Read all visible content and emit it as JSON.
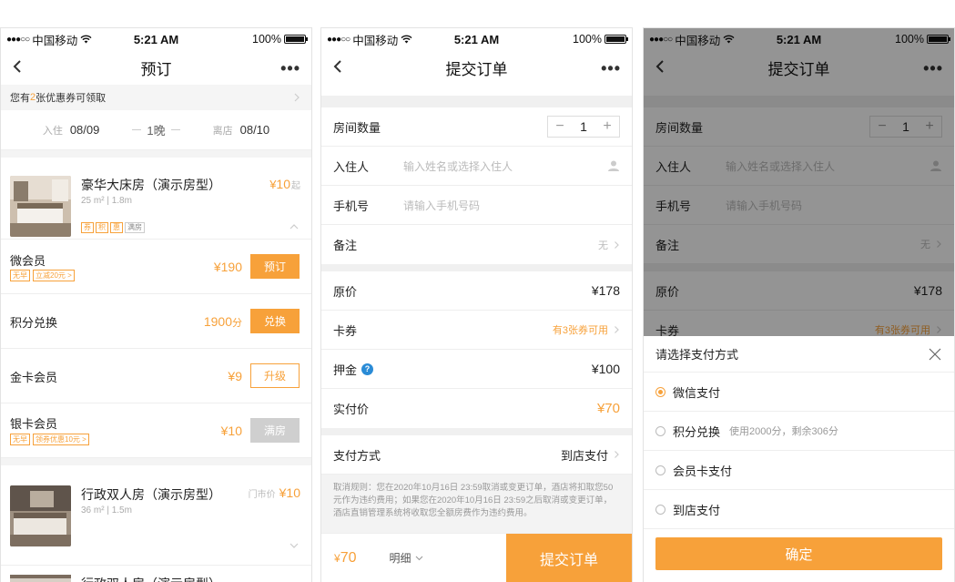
{
  "status": {
    "dots": "●●●○○",
    "carrier": "中国移动",
    "time": "5:21 AM",
    "battery": "100%"
  },
  "screen1": {
    "title": "预订",
    "coupon_pre": "您有 ",
    "coupon_num": "2",
    "coupon_post": " 张优惠券可领取",
    "checkin_label": "入住",
    "checkin_date": "08/09",
    "nights": "1晚",
    "checkout_label": "离店",
    "checkout_date": "08/10",
    "room1": {
      "name": "豪华大床房（演示房型）",
      "spec": "25 m² | 1.8m",
      "tags": [
        "券",
        "积",
        "惠",
        "满房"
      ],
      "price_sym": "¥",
      "price": "10",
      "suffix": "起"
    },
    "plans": [
      {
        "name": "微会员",
        "tags": [
          "无早",
          "立减20元 >"
        ],
        "price": "¥190",
        "button": "预订"
      },
      {
        "name": "积分兑换",
        "price": "1900",
        "price_unit": "分",
        "button": "兑换"
      },
      {
        "name": "金卡会员",
        "price": "¥9",
        "button": "升级"
      },
      {
        "name": "银卡会员",
        "tags": [
          "无早",
          "领券优惠10元 >"
        ],
        "price": "¥10",
        "button": "满房"
      }
    ],
    "room2": {
      "name": "行政双人房（演示房型）",
      "spec": "36 m² | 1.5m",
      "market_label": "门市价",
      "price": "¥10"
    },
    "room3": {
      "name": "行政双人房（演示房型）"
    }
  },
  "screen2": {
    "title": "提交订单",
    "room_count_label": "房间数量",
    "room_count": "1",
    "guest_label": "入住人",
    "guest_placeholder": "输入姓名或选择入住人",
    "phone_label": "手机号",
    "phone_placeholder": "请输入手机号码",
    "remark_label": "备注",
    "remark_value": "无",
    "original_label": "原价",
    "original_price": "¥178",
    "coupon_label": "卡券",
    "coupon_value": "有3张券可用",
    "deposit_label": "押金",
    "deposit_value": "¥100",
    "actual_label": "实付价",
    "actual_value": "¥70",
    "pay_label": "支付方式",
    "pay_value": "到店支付",
    "rules": "取消规则：您在2020年10月16日 23:59取消或变更订单，酒店将扣取您50元作为违约费用；如果您在2020年10月16日 23:59之后取消或变更订单，酒店直销管理系统将收取您全额房费作为违约费用。",
    "total_sym": "¥",
    "total": "70",
    "detail_label": "明细",
    "submit_label": "提交订单"
  },
  "screen3": {
    "sheet_title": "请选择支付方式",
    "options": [
      {
        "label": "微信支付",
        "selected": true
      },
      {
        "label": "积分兑换",
        "note": "使用2000分，剩余306分"
      },
      {
        "label": "会员卡支付"
      },
      {
        "label": "到店支付"
      }
    ],
    "confirm_label": "确定"
  },
  "colors": {
    "accent": "#f7a13a",
    "disabled": "#cfcfcf",
    "info": "#2a8bd6"
  },
  "icons": [
    "back-icon",
    "more-icon",
    "wifi-icon",
    "battery-icon",
    "chevron-right-icon",
    "chevron-up-icon",
    "chevron-down-icon",
    "person-icon",
    "question-icon",
    "close-icon",
    "radio-icon"
  ]
}
